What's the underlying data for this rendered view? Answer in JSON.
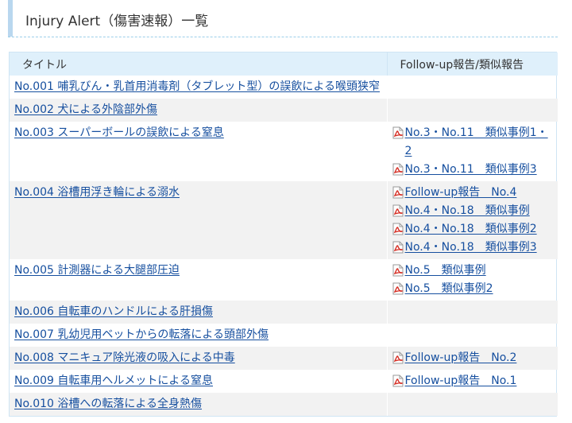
{
  "page": {
    "title": "Injury Alert（傷害速報）一覧"
  },
  "table": {
    "headers": {
      "title": "タイトル",
      "links": "Follow-up報告/類似報告"
    },
    "rows": [
      {
        "title": "No.001 哺乳びん・乳首用消毒剤（タブレット型）の誤飲による喉頭狭窄",
        "links": []
      },
      {
        "title": "No.002 犬による外陰部外傷",
        "links": []
      },
      {
        "title": "No.003 スーパーボールの誤飲による窒息",
        "links": [
          "No.3・No.11　類似事例1・2",
          "No.3・No.11　類似事例3"
        ]
      },
      {
        "title": "No.004 浴槽用浮き輪による溺水",
        "links": [
          "Follow-up報告　No.4",
          "No.4・No.18　類似事例",
          "No.4・No.18　類似事例2",
          "No.4・No.18　類似事例3"
        ]
      },
      {
        "title": "No.005 計測器による大腿部圧迫",
        "links": [
          "No.5　類似事例",
          "No.5　類似事例2"
        ]
      },
      {
        "title": "No.006 自転車のハンドルによる肝損傷",
        "links": []
      },
      {
        "title": "No.007 乳幼児用ベットからの転落による頭部外傷",
        "links": []
      },
      {
        "title": "No.008 マニキュア除光液の吸入による中毒",
        "links": [
          "Follow-up報告　No.2"
        ]
      },
      {
        "title": "No.009 自転車用ヘルメットによる窒息",
        "links": [
          "Follow-up報告　No.1"
        ]
      },
      {
        "title": "No.010 浴槽への転落による全身熱傷",
        "links": []
      }
    ]
  },
  "icons": {
    "pdf": "pdf-icon"
  },
  "colors": {
    "heading_bar": "#b9d7ef",
    "header_bg": "#dff0fb",
    "link": "#164f9f",
    "row_alt": "#f2f2f2",
    "pdf_red": "#d62f25"
  }
}
